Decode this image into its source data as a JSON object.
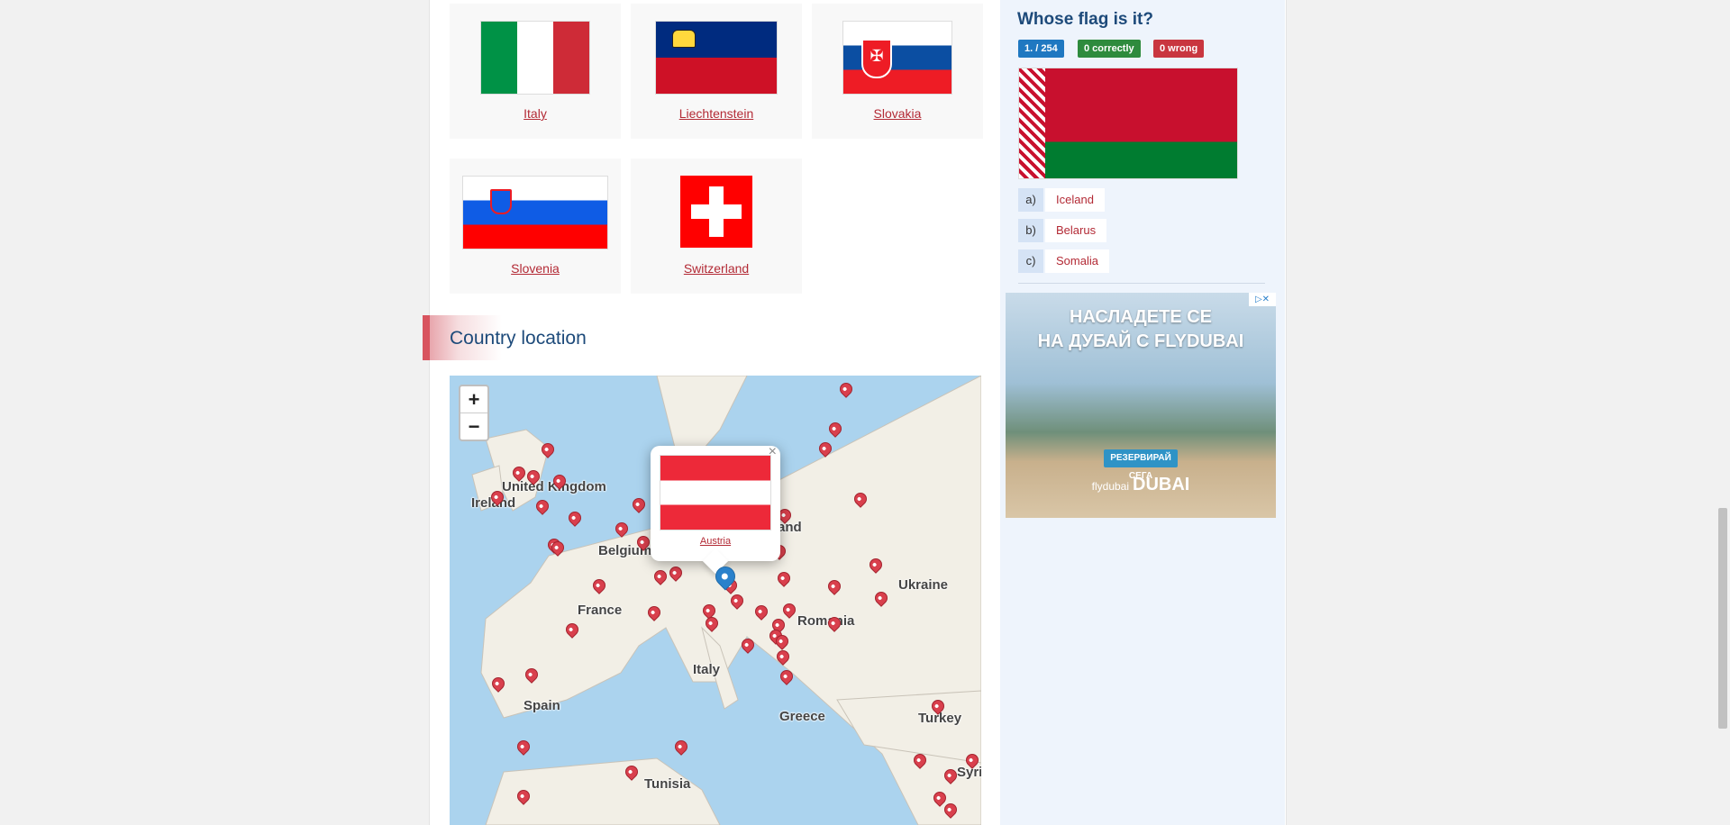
{
  "flag_cards": [
    {
      "name": "Italy"
    },
    {
      "name": "Liechtenstein"
    },
    {
      "name": "Slovakia"
    },
    {
      "name": "Slovenia"
    },
    {
      "name": "Switzerland"
    }
  ],
  "section": {
    "title": "Country location"
  },
  "map": {
    "zoom_in": "+",
    "zoom_out": "−",
    "labels": [
      "United Kingdom",
      "Ireland",
      "Belgium",
      "France",
      "Spain",
      "Italy",
      "Tunisia",
      "Greece",
      "Turkey",
      "Romania",
      "Ukraine",
      "and",
      "Syri"
    ],
    "popup": {
      "country": "Austria",
      "close": "×"
    }
  },
  "quiz": {
    "title": "Whose flag is it?",
    "progress": "1. / 254",
    "correct": "0  correctly",
    "wrong": "0  wrong",
    "answers": [
      {
        "letter": "a)",
        "text": "Iceland"
      },
      {
        "letter": "b)",
        "text": "Belarus"
      },
      {
        "letter": "c)",
        "text": "Somalia"
      }
    ]
  },
  "ad": {
    "line1": "НАСЛАДЕТЕ СЕ",
    "line2": "НА ДУБАЙ С FLYDUBAI",
    "cta": "РЕЗЕРВИРАЙ СЕГА",
    "brand_small": "flydubai",
    "brand": "DUBAI"
  },
  "colors": {
    "accent_red": "#b32a35",
    "title_blue": "#1d4a7a",
    "badge_blue": "#1f78c1",
    "badge_green": "#2e8b3d",
    "badge_red": "#c9363f"
  }
}
